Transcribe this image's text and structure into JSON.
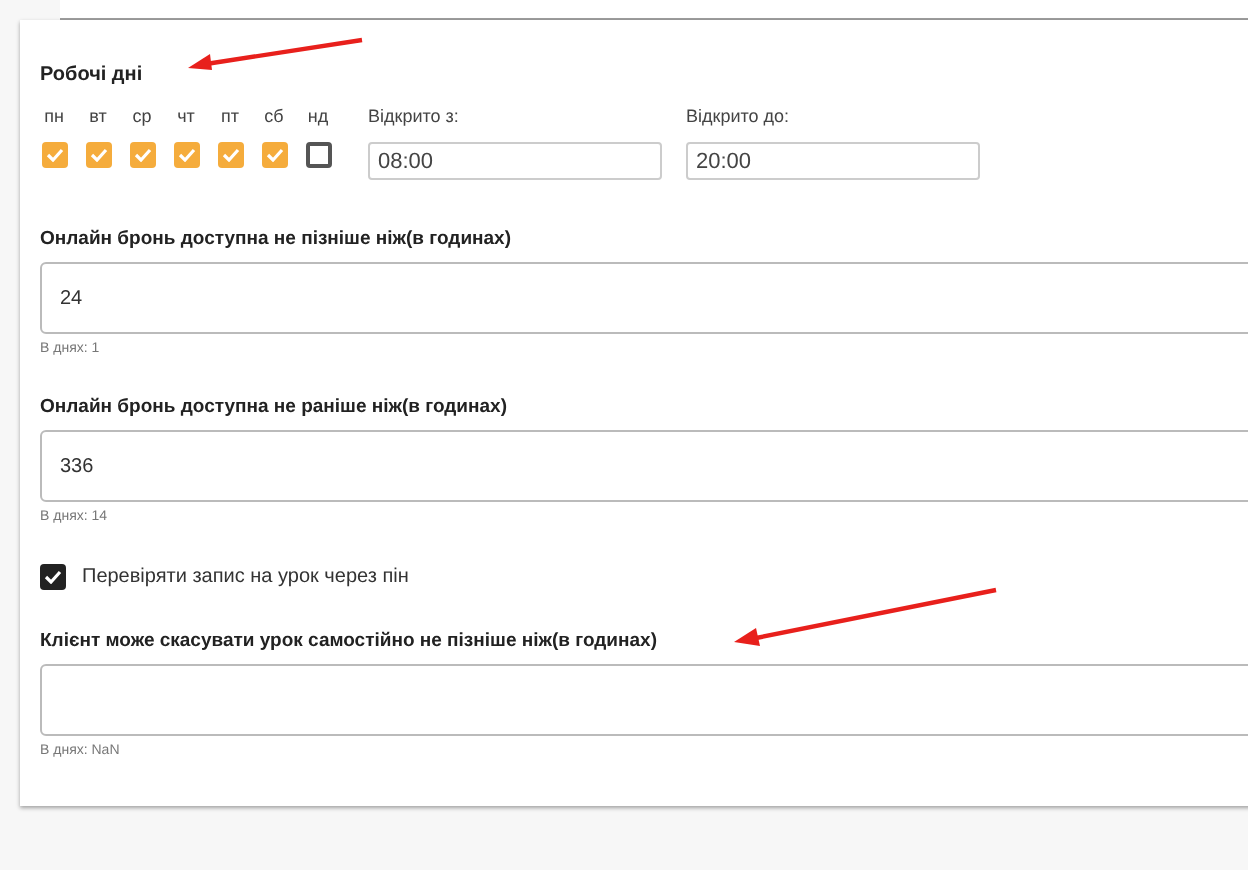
{
  "working_days": {
    "title": "Робочі дні",
    "days": [
      {
        "label": "пн",
        "checked": true
      },
      {
        "label": "вт",
        "checked": true
      },
      {
        "label": "ср",
        "checked": true
      },
      {
        "label": "чт",
        "checked": true
      },
      {
        "label": "пт",
        "checked": true
      },
      {
        "label": "сб",
        "checked": true
      },
      {
        "label": "нд",
        "checked": false
      }
    ],
    "open_from": {
      "label": "Відкрито з:",
      "value": "08:00"
    },
    "open_to": {
      "label": "Відкрито до:",
      "value": "20:00"
    }
  },
  "booking_latest": {
    "label": "Онлайн бронь доступна не пізніше ніж(в годинах)",
    "value": "24",
    "hint": "В днях: 1"
  },
  "booking_earliest": {
    "label": "Онлайн бронь доступна не раніше ніж(в годинах)",
    "value": "336",
    "hint": "В днях: 14"
  },
  "pin_check": {
    "label": "Перевіряти запис на урок через пін",
    "checked": true
  },
  "cancel_limit": {
    "label": "Клієнт може скасувати урок самостійно не пізніше ніж(в годинах)",
    "hint": "В днях: NaN"
  }
}
